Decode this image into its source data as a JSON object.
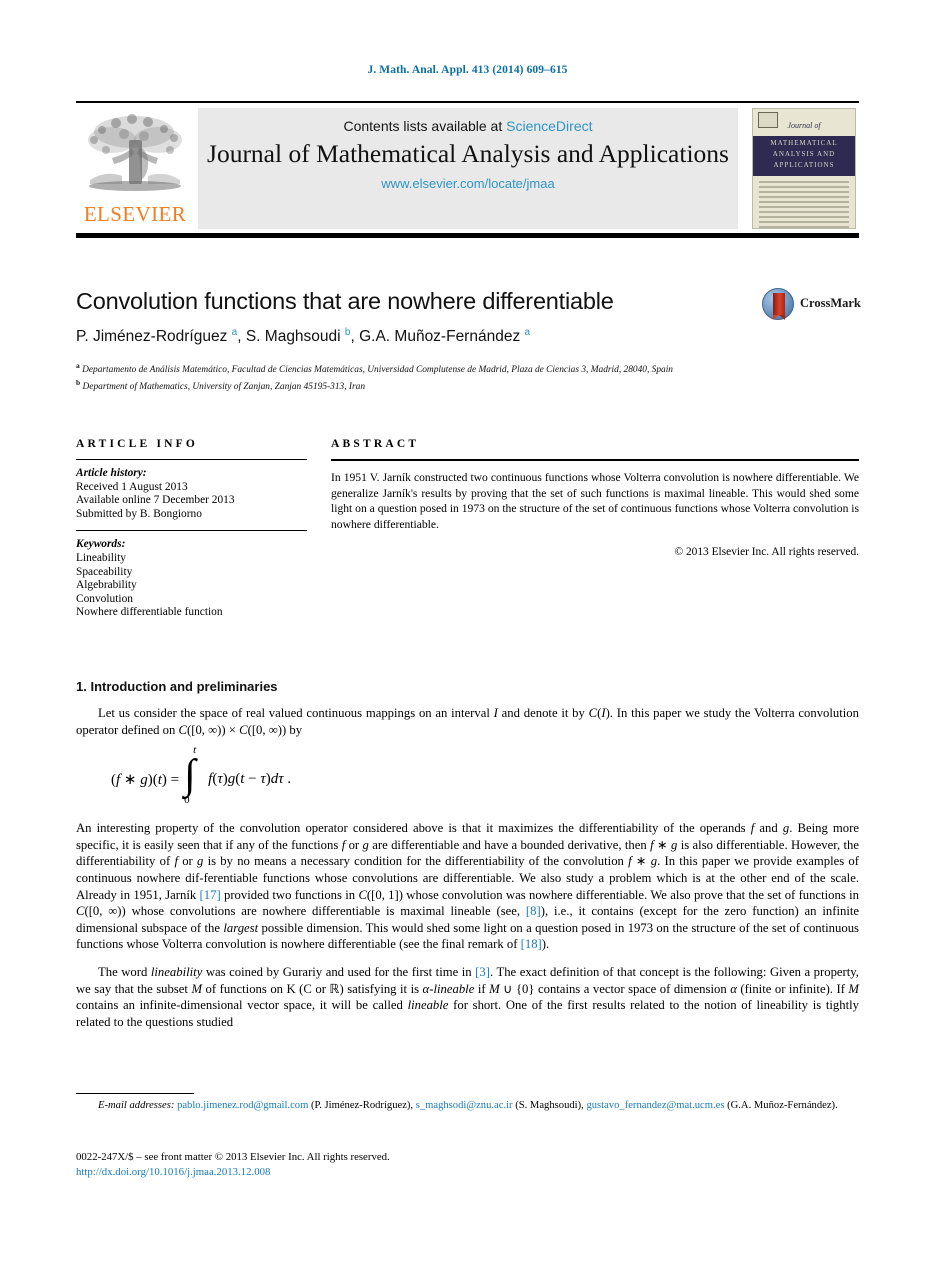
{
  "running_head": "J. Math. Anal. Appl. 413 (2014) 609–615",
  "masthead": {
    "contents_prefix": "Contents lists available at ",
    "sciencedirect": "ScienceDirect",
    "journal_title": "Journal of Mathematical Analysis and Applications",
    "journal_url": "www.elsevier.com/locate/jmaa",
    "publisher_name": "ELSEVIER",
    "cover_journal_of": "Journal of",
    "cover_title_line1": "MATHEMATICAL",
    "cover_title_line2": "ANALYSIS AND",
    "cover_title_line3": "APPLICATIONS"
  },
  "article": {
    "title": "Convolution functions that are nowhere differentiable",
    "authors_html": "P. Jiménez-Rodríguez <sup>a</sup>, S. Maghsoudi <sup>b</sup>, G.A. Muñoz-Fernández <sup>a</sup>",
    "affiliation_a": "Departamento de Análisis Matemático, Facultad de Ciencias Matemáticas, Universidad Complutense de Madrid, Plaza de Ciencias 3, Madrid, 28040, Spain",
    "affiliation_b": "Department of Mathematics, University of Zanjan, Zanjan 45195-313, Iran",
    "crossmark_label": "CrossMark"
  },
  "info": {
    "heading": "ARTICLE INFO",
    "history_label": "Article history:",
    "history": [
      "Received 1 August 2013",
      "Available online 7 December 2013",
      "Submitted by B. Bongiorno"
    ],
    "keywords_label": "Keywords:",
    "keywords": [
      "Lineability",
      "Spaceability",
      "Algebrability",
      "Convolution",
      "Nowhere differentiable function"
    ]
  },
  "abstract": {
    "heading": "ABSTRACT",
    "text": "In 1951 V. Jarník constructed two continuous functions whose Volterra convolution is nowhere differentiable. We generalize Jarník's results by proving that the set of such functions is maximal lineable. This would shed some light on a question posed in 1973 on the structure of the set of continuous functions whose Volterra convolution is nowhere differentiable.",
    "copyright": "© 2013 Elsevier Inc. All rights reserved."
  },
  "body": {
    "section_heading": "1. Introduction and preliminaries",
    "equation_text": "(f ∗ g)(t) = ∫₀ᵗ f(τ)g(t − τ)dτ.",
    "equation_parts": {
      "lhs": "(f ∗ g)(t) =",
      "upper_limit": "t",
      "lower_limit": "0",
      "integrand": "f(τ)g(t − τ)dτ ."
    }
  },
  "footnotes": {
    "email_label": "E-mail addresses:",
    "emails": [
      {
        "address": "pablo.jimenez.rod@gmail.com",
        "owner": "(P. Jiménez-Rodríguez)"
      },
      {
        "address": "s_maghsodi@znu.ac.ir",
        "owner": "(S. Maghsoudi)"
      },
      {
        "address": "gustavo_fernandez@mat.ucm.es",
        "owner": "(G.A. Muñoz-Fernández)."
      }
    ],
    "issn_line": "0022-247X/$ – see front matter  © 2013 Elsevier Inc. All rights reserved.",
    "doi": "http://dx.doi.org/10.1016/j.jmaa.2013.12.008"
  },
  "colors": {
    "link": "#1a7bb9",
    "runhead": "#0b6fa4",
    "elsevier_orange": "#f47c20",
    "masthead_bg": "#e9e9e9"
  }
}
